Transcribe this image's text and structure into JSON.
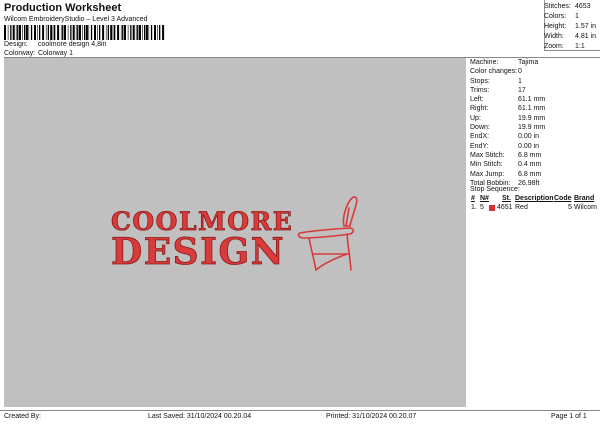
{
  "header": {
    "title": "Production Worksheet",
    "subtitle": "Wilcom EmbroideryStudio – Level 3 Advanced",
    "design_label": "Design:",
    "design_value": "coolmore design 4,8in",
    "colorway_label": "Colorway:",
    "colorway_value": "Colorway 1"
  },
  "stats": [
    {
      "label": "Stitches:",
      "value": "4653"
    },
    {
      "label": "Colors:",
      "value": "1"
    },
    {
      "label": "Height:",
      "value": "1.57 in"
    },
    {
      "label": "Width:",
      "value": "4.81 in"
    },
    {
      "label": "Zoom:",
      "value": "1:1"
    }
  ],
  "design": {
    "line1": "COOLMORE",
    "line2": "DESIGN",
    "thread_color": "#d93a3a"
  },
  "machine": [
    {
      "label": "Machine:",
      "value": "Tajima"
    },
    {
      "label": "Color changes:",
      "value": "0"
    },
    {
      "label": "Stops:",
      "value": "1"
    },
    {
      "label": "Trims:",
      "value": "17"
    },
    {
      "label": "Left:",
      "value": "61.1 mm"
    },
    {
      "label": "Right:",
      "value": "61.1 mm"
    },
    {
      "label": "Up:",
      "value": "19.9 mm"
    },
    {
      "label": "Down:",
      "value": "19.9 mm"
    },
    {
      "label": "EndX:",
      "value": "0.00 in"
    },
    {
      "label": "EndY:",
      "value": "0.00 in"
    },
    {
      "label": "Max Stitch:",
      "value": "6.8 mm"
    },
    {
      "label": "Min Stitch:",
      "value": "0.4 mm"
    },
    {
      "label": "Max Jump:",
      "value": "6.8 mm"
    },
    {
      "label": "Total Bobbin:",
      "value": "26.98ft"
    }
  ],
  "stop_sequence": {
    "title": "Stop Sequence:",
    "headers": {
      "num": "#",
      "n": "N#",
      "st": "St.",
      "desc": "Description",
      "code": "Code",
      "brand": "Brand"
    },
    "rows": [
      {
        "num": "1.",
        "n": "5",
        "st": "4651",
        "desc": "Red",
        "code": "5",
        "brand": "Wilcom",
        "color": "#d33333"
      }
    ]
  },
  "footer": {
    "created_by": "Created By:",
    "last_saved": "Last Saved: 31/10/2024 00.20.04",
    "printed": "Printed: 31/10/2024 00.20.07",
    "page": "Page 1 of 1"
  }
}
